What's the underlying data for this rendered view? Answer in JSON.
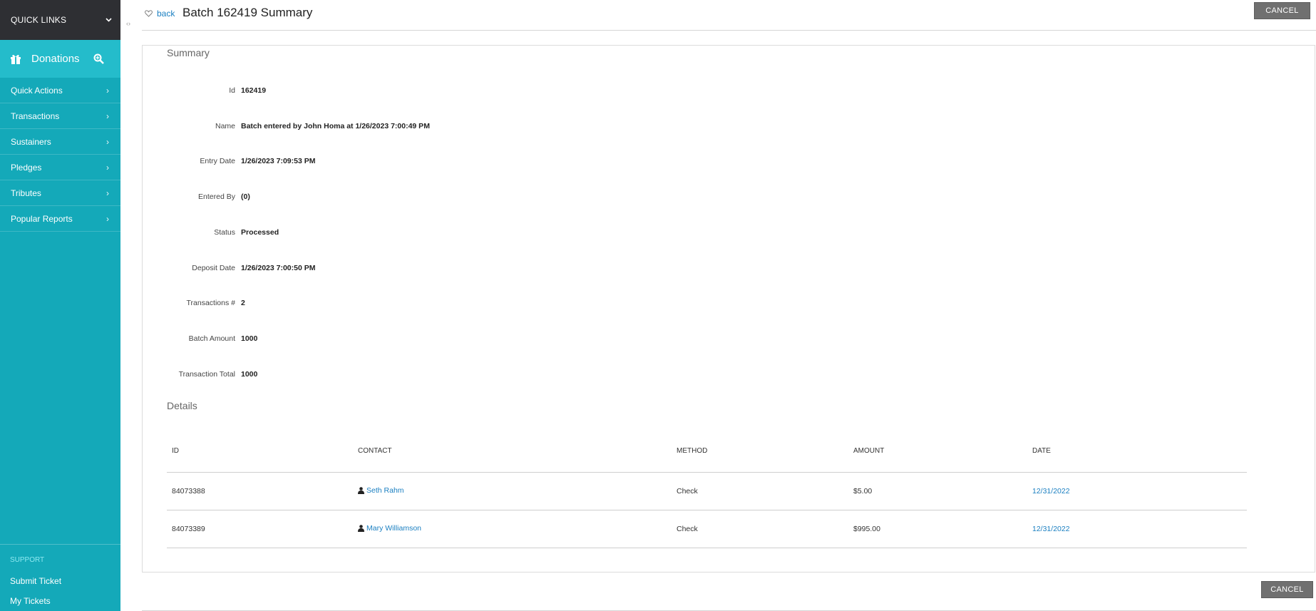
{
  "sidebar": {
    "quick_links": "QUICK LINKS",
    "module": {
      "label": "Donations",
      "icon": "gift-icon",
      "search_icon": "search-icon"
    },
    "items": [
      {
        "label": "Quick Actions"
      },
      {
        "label": "Transactions"
      },
      {
        "label": "Sustainers"
      },
      {
        "label": "Pledges"
      },
      {
        "label": "Tributes"
      },
      {
        "label": "Popular Reports"
      }
    ],
    "support": {
      "title": "SUPPORT",
      "submit_ticket": "Submit Ticket",
      "my_tickets": "My Tickets"
    }
  },
  "header": {
    "back_label": "back",
    "title": "Batch 162419 Summary",
    "cancel_label": "CANCEL"
  },
  "summary": {
    "title": "Summary",
    "fields": [
      {
        "label": "Id",
        "value": "162419"
      },
      {
        "label": "Name",
        "value": "Batch entered by John Homa at 1/26/2023 7:00:49 PM"
      },
      {
        "label": "Entry Date",
        "value": "1/26/2023 7:09:53 PM"
      },
      {
        "label": "Entered By",
        "value": "(0)"
      },
      {
        "label": "Status",
        "value": "Processed"
      },
      {
        "label": "Deposit Date",
        "value": "1/26/2023 7:00:50 PM"
      },
      {
        "label": "Transactions #",
        "value": "2"
      },
      {
        "label": "Batch Amount",
        "value": "1000"
      },
      {
        "label": "Transaction Total",
        "value": "1000"
      }
    ]
  },
  "details": {
    "title": "Details",
    "columns": [
      "ID",
      "CONTACT",
      "METHOD",
      "AMOUNT",
      "DATE"
    ],
    "rows": [
      {
        "id": "84073388",
        "contact": "Seth Rahm",
        "method": "Check",
        "amount": "$5.00",
        "date": "12/31/2022"
      },
      {
        "id": "84073389",
        "contact": "Mary Williamson",
        "method": "Check",
        "amount": "$995.00",
        "date": "12/31/2022"
      }
    ]
  },
  "footer": {
    "cancel_label": "CANCEL"
  },
  "colors": {
    "sidebar": "#14a9b9",
    "module": "#24bccb",
    "quick_links_bg": "#2e2f33",
    "link": "#1a7fc1",
    "button": "#707070"
  }
}
